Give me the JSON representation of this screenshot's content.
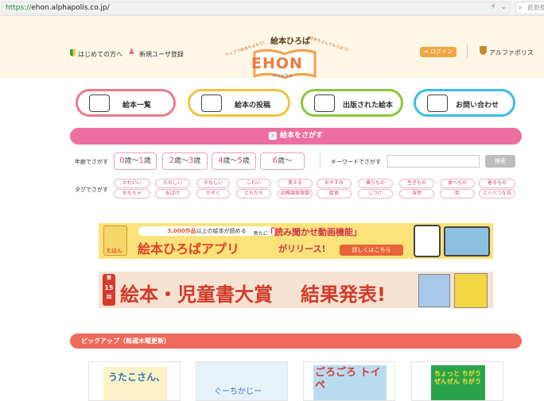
{
  "browser": {
    "url_scheme": "https://",
    "url_rest": "ehon.alphapolis.co.jp/",
    "search_placeholder": "此处搜"
  },
  "header": {
    "first_time": "はじめての方へ",
    "register": "新規ユーザ登録",
    "logo_title": "絵本ひろば",
    "logo_main": "EHON",
    "logo_sub": "hiroba",
    "logo_tag_left": "ウェブで絵本をよもう!",
    "logo_tag_right": "絵本をよんでもらおう!",
    "login": "ログイン",
    "alphapolis": "アルファポリス"
  },
  "nav": [
    {
      "label": "絵本一覧",
      "color": "#ee7a85"
    },
    {
      "label": "絵本の投稿",
      "color": "#f0c43c"
    },
    {
      "label": "出版された絵本",
      "color": "#8cc63f"
    },
    {
      "label": "お問い合わせ",
      "color": "#3bbde4"
    }
  ],
  "search": {
    "title": "絵本をさがす",
    "age_label": "年齢でさがす",
    "ages": [
      {
        "a": "0",
        "mid": "歳〜",
        "b": "1",
        "end": "歳"
      },
      {
        "a": "2",
        "mid": "歳〜",
        "b": "3",
        "end": "歳"
      },
      {
        "a": "4",
        "mid": "歳〜",
        "b": "5",
        "end": "歳"
      },
      {
        "a": "6",
        "mid": "歳〜",
        "b": "",
        "end": ""
      }
    ],
    "keyword_label": "キーワードでさがす",
    "submit": "検索",
    "tag_label": "タグでさがす",
    "tags_row1": [
      "かわいい",
      "たのしい",
      "かなしい",
      "こわい",
      "笑える",
      "おやすみ",
      "乗りもの",
      "生きもの",
      "食べもの",
      "着るもの"
    ],
    "tags_row2": [
      "おもちゃ",
      "おばけ",
      "かぞく",
      "ともだち",
      "幼稚園保育園",
      "絵食",
      "しつけ",
      "自然",
      "街",
      "とくべつな日"
    ]
  },
  "banner1": {
    "badge": "えほん",
    "line1_num": "3,000作品",
    "line1_rest": "以上の絵本が読める",
    "app": "絵本ひろばアプリ",
    "new": "新たに",
    "feature": "「読み聞かせ動画機能」",
    "release": "がリリース!",
    "more": "詳しくはこちら"
  },
  "banner2": {
    "round_top": "第",
    "round_num": "15",
    "round_bot": "回",
    "title": "絵本・児童書大賞",
    "result": "結果発表!"
  },
  "pickup": {
    "title": "ピックアップ（毎週木曜更新）",
    "cards": [
      {
        "text": "うたこさん、"
      },
      {
        "text": "ぐーちかじー"
      },
      {
        "text": "ごろごろ トイペ"
      },
      {
        "text": "ちょっと ちがう ぜんぜん ちがう"
      }
    ]
  },
  "colors": {
    "search_pink": "#ed6ea0",
    "pickup_red": "#ee6a5a",
    "header_bg": "#fef6e6",
    "login_orange": "#f2a543"
  }
}
